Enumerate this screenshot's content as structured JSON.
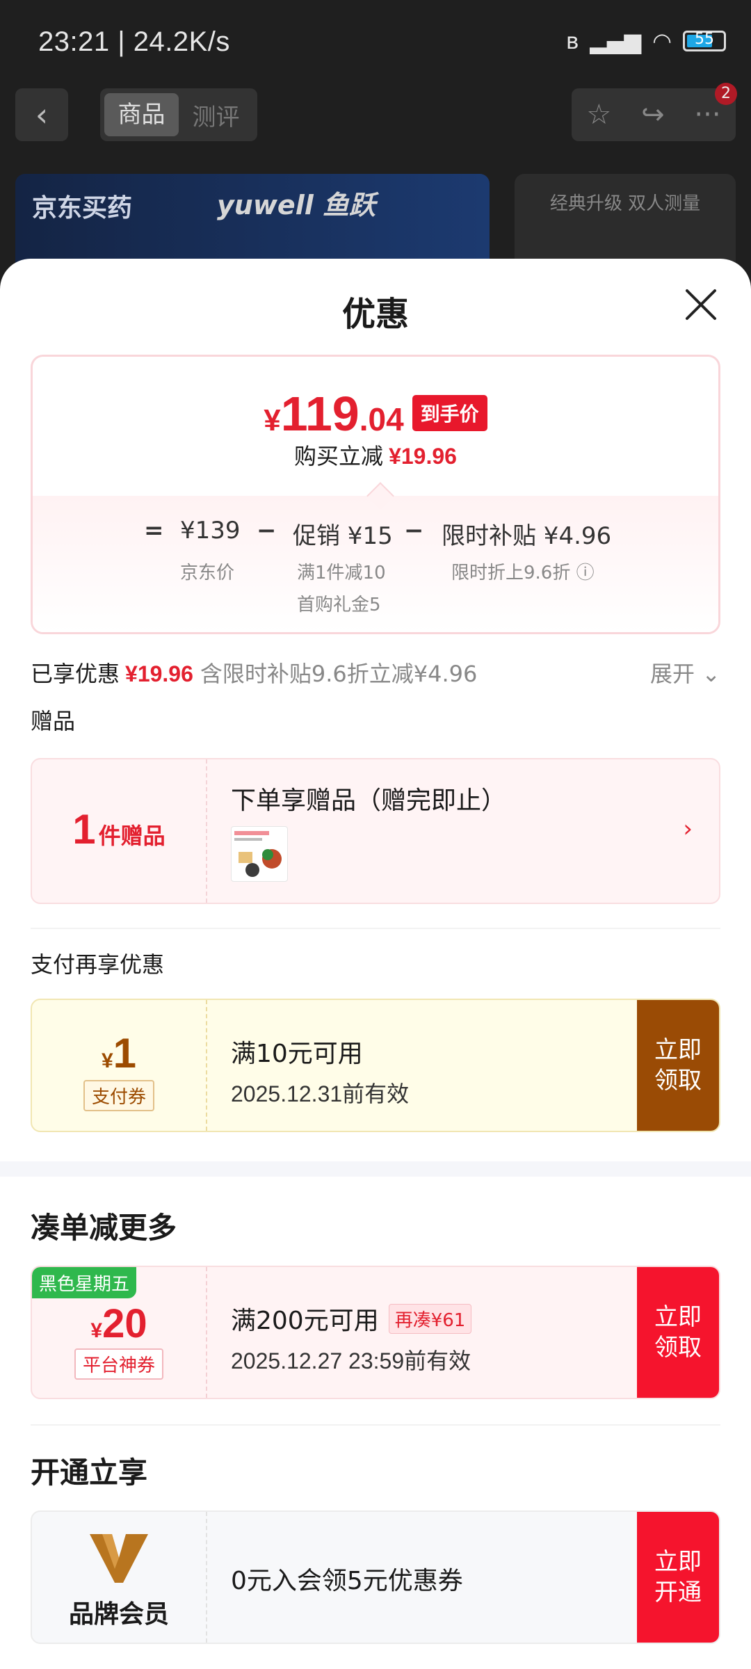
{
  "status_bar": {
    "time": "23:21 | 24.2K/s",
    "battery": "55"
  },
  "background": {
    "tabs": [
      "商品",
      "测评"
    ],
    "cart_badge": "2",
    "banner_left_brand": "京东买药",
    "banner_left_brand2": "yuwell 鱼跃",
    "banner_right_text": "经典升级 双人测量"
  },
  "sheet": {
    "title": "优惠",
    "price": {
      "symbol": "¥",
      "integer": "119",
      "decimal": ".04",
      "tag": "到手价",
      "save_label": "购买立减",
      "save_value": "¥19.96"
    },
    "formula": {
      "eq": "=",
      "jd_price": "¥139",
      "jd_price_label": "京东价",
      "minus1": "−",
      "promo": "促销 ¥15",
      "promo_sub1": "满1件减10",
      "promo_sub2": "首购礼金5",
      "minus2": "−",
      "subsidy": "限时补贴 ¥4.96",
      "subsidy_sub": "限时折上9.6折"
    },
    "enjoyed": {
      "label": "已享优惠",
      "value": "¥19.96",
      "detail": "含限时补贴9.6折立减¥4.96",
      "expand": "展开"
    },
    "gift_section": {
      "label": "赠品",
      "count": "1",
      "unit": "件赠品",
      "title": "下单享赠品（赠完即止）"
    },
    "pay_section": {
      "label": "支付再享优惠",
      "amount_symbol": "¥",
      "amount": "1",
      "tag": "支付券",
      "condition": "满10元可用",
      "expiry": "2025.12.31前有效",
      "button": [
        "立即",
        "领取"
      ]
    },
    "more_section": {
      "title": "凑单减更多",
      "ribbon": "黑色星期五",
      "amount_symbol": "¥",
      "amount": "20",
      "tag": "平台神券",
      "condition": "满200元可用",
      "extra": "再凑¥61",
      "expiry": "2025.12.27 23:59前有效",
      "button": [
        "立即",
        "领取"
      ]
    },
    "open_section": {
      "title": "开通立享",
      "member_label": "品牌会员",
      "text": "0元入会领5元优惠券",
      "button": [
        "立即",
        "开通"
      ]
    }
  },
  "colors": {
    "accent_red": "#e3202f",
    "button_brown": "#9a4b05",
    "ribbon_green": "#2fb84d"
  }
}
